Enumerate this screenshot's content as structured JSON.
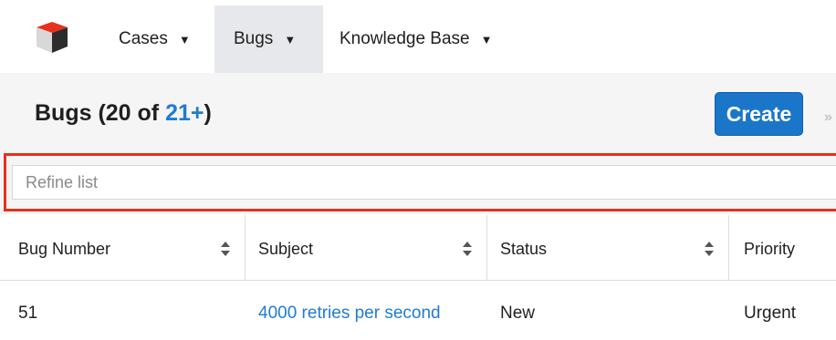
{
  "nav": {
    "items": [
      {
        "label": "Cases"
      },
      {
        "label": "Bugs"
      },
      {
        "label": "Knowledge Base"
      }
    ]
  },
  "header": {
    "module": "Bugs",
    "count_prefix": "(20 of ",
    "count_link": "21+",
    "count_suffix": ")",
    "create_label": "Create"
  },
  "search": {
    "placeholder": "Refine list"
  },
  "table": {
    "columns": [
      {
        "label": "Bug Number"
      },
      {
        "label": "Subject"
      },
      {
        "label": "Status"
      },
      {
        "label": "Priority"
      }
    ],
    "rows": [
      {
        "bug_number": "51",
        "subject": "4000 retries per second",
        "status": "New",
        "priority": "Urgent"
      }
    ]
  },
  "colors": {
    "accent": "#1b76c9",
    "link": "#1f7ccf",
    "highlight": "#e8301c",
    "header_bg": "#f5f5f5"
  }
}
